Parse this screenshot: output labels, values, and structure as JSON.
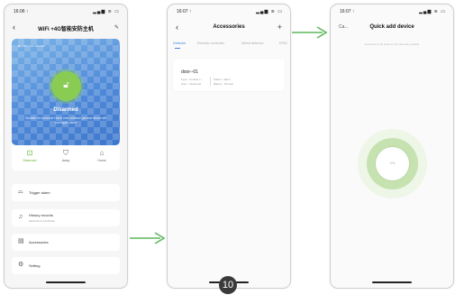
{
  "phone1": {
    "time": "16:06 ↑",
    "signal": "▂▄▆ ≋ ▭",
    "title": "WiFi +4G智能安防主机",
    "info": "▣ 50% ⬚ No sim card",
    "state": "Disarmed",
    "description": "Suitable for someone Home zone attribute general device will not trigger alarm",
    "modes": [
      {
        "label": "Disarmed",
        "icon": "unlock-icon",
        "glyph": "🔓"
      },
      {
        "label": "Away",
        "icon": "shield-icon",
        "glyph": "⛉"
      },
      {
        "label": "Home",
        "icon": "home-icon",
        "glyph": "⌂"
      }
    ],
    "menu": {
      "trigger_alarm": "Trigger alarm",
      "history": "History records",
      "history_time": "2020-09-11 16:05 DR",
      "accessories": "Accessories",
      "setting": "Setting"
    },
    "accent": "#63b132"
  },
  "phone2": {
    "time": "16:07 ↑",
    "signal": "▂▄▆ ≋ ▭",
    "title": "Accessories",
    "tabs": [
      "Detector",
      "Remote controller",
      "Wired detector",
      "RFID"
    ],
    "device": {
      "name": "door--01",
      "type": "Type : Contact s...",
      "zone": "Zone : Disarmed",
      "status": "Status : Alarm",
      "battery": "Battery : Normal"
    },
    "accent": "#3f86d8"
  },
  "phone3": {
    "time": "16:07 ↑",
    "signal": "▂▄▆ ≋ ▭",
    "cancel": "Ca...",
    "title": "Quick add device",
    "hint": "accessory is as close to the panel as possible",
    "center": "0%"
  },
  "page_number": "10"
}
